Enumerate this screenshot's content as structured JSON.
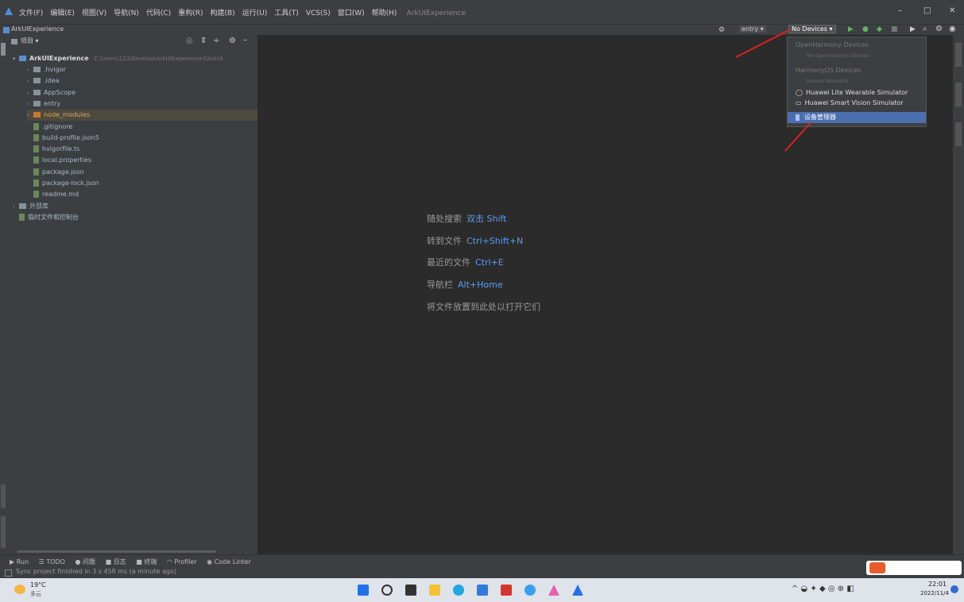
{
  "window": {
    "app_title": "ArkUIExperience",
    "menu": [
      "文件(F)",
      "编辑(E)",
      "视图(V)",
      "导航(N)",
      "代码(C)",
      "重构(R)",
      "构建(B)",
      "运行(U)",
      "工具(T)",
      "VCS(S)",
      "窗口(W)",
      "帮助(H)"
    ],
    "controls": {
      "minimize": "–",
      "maximize": "□",
      "close": "✕"
    }
  },
  "navbar": {
    "breadcrumb": "ArkUIExperience",
    "module_select": "entry ▾",
    "device_select": "No Devices ▾"
  },
  "project_panel": {
    "header": "项目 ▾",
    "root": "ArkUIExperience",
    "root_path": "C:\\Users\\123\\Desktop\\ArkUIExperience1\\ArkUI",
    "items": [
      {
        "label": ".hvigor",
        "type": "folder"
      },
      {
        "label": ".idea",
        "type": "folder"
      },
      {
        "label": "AppScope",
        "type": "folder"
      },
      {
        "label": "entry",
        "type": "folder"
      },
      {
        "label": "node_modules",
        "type": "folder",
        "selected": true
      },
      {
        "label": ".gitignore",
        "type": "file"
      },
      {
        "label": "build-profile.json5",
        "type": "file"
      },
      {
        "label": "hvigorfile.ts",
        "type": "file"
      },
      {
        "label": "local.properties",
        "type": "file"
      },
      {
        "label": "package.json",
        "type": "file"
      },
      {
        "label": "package-lock.json",
        "type": "file"
      },
      {
        "label": "readme.md",
        "type": "file"
      },
      {
        "label": "外部库",
        "type": "folder"
      },
      {
        "label": "临时文件和控制台",
        "type": "file"
      }
    ]
  },
  "editor_hints": [
    {
      "text": "随处搜索",
      "key": "双击 Shift"
    },
    {
      "text": "转到文件",
      "key": "Ctrl+Shift+N"
    },
    {
      "text": "最近的文件",
      "key": "Ctrl+E"
    },
    {
      "text": "导航栏",
      "key": "Alt+Home"
    },
    {
      "text": "将文件放置到此处以打开它们",
      "key": ""
    }
  ],
  "device_menu": {
    "section1": "OpenHarmony Devices",
    "section1_empty": "No OpenHarmony Devices",
    "section2": "HarmonyOS Devices",
    "section2_empty": "Huawei Wearable",
    "items": [
      "Huawei Lite Wearable Simulator",
      "Huawei Smart Vision Simulator"
    ],
    "manager": "设备管理器"
  },
  "tool_windows": [
    "Run",
    "TODO",
    "问题",
    "日志",
    "终端",
    "Profiler",
    "Code Linter"
  ],
  "status_text": "Sync project finished in 3 s 458 ms (a minute ago)",
  "taskbar": {
    "weather_temp": "19°C",
    "weather_desc": "多云",
    "time": "22:01",
    "date": "2022/11/4"
  },
  "colors": {
    "accent": "#4b6eaf",
    "link": "#589df6",
    "arrow": "#e02020"
  }
}
